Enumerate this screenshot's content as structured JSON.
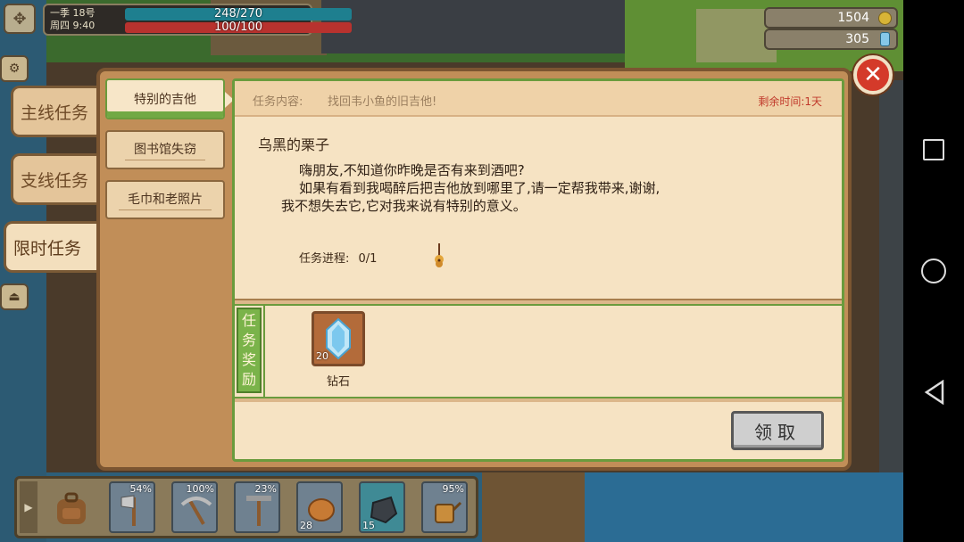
{
  "status": {
    "season_day": "一季 18号",
    "weekday_time": "周四 9:40",
    "energy": "248/270",
    "health": "100/100"
  },
  "currency": {
    "coins": "1504",
    "gems": "305"
  },
  "quest_tabs": [
    {
      "label": "主线任务"
    },
    {
      "label": "支线任务"
    },
    {
      "label": "限时任务"
    }
  ],
  "quest_list": [
    {
      "label": "特别的吉他"
    },
    {
      "label": "图书馆失窃"
    },
    {
      "label": "毛巾和老照片"
    }
  ],
  "quest": {
    "content_label": "任务内容:",
    "content": "找回韦小鱼的旧吉他!",
    "time_left": "剩余时间:1天",
    "npc_name": "乌黑的栗子",
    "dialog_line1": "嗨朋友,不知道你昨晚是否有来到酒吧?",
    "dialog_line2": "如果有看到我喝醉后把吉他放到哪里了,请一定帮我带来,谢谢,",
    "dialog_line3": "我不想失去它,它对我来说有特别的意义。",
    "progress_label": "任务进程:",
    "progress_value": "0/1"
  },
  "reward": {
    "tag": "任务奖励",
    "item_name": "钻石",
    "item_count": "20"
  },
  "claim_label": "领取",
  "hotbar": {
    "slots": [
      {
        "name": "axe",
        "pct": "54%"
      },
      {
        "name": "pickaxe",
        "pct": "100%"
      },
      {
        "name": "hoe",
        "pct": "23%"
      },
      {
        "name": "bread",
        "count": "28"
      },
      {
        "name": "ore",
        "count": "15"
      },
      {
        "name": "watering-can",
        "pct": "95%"
      }
    ]
  }
}
